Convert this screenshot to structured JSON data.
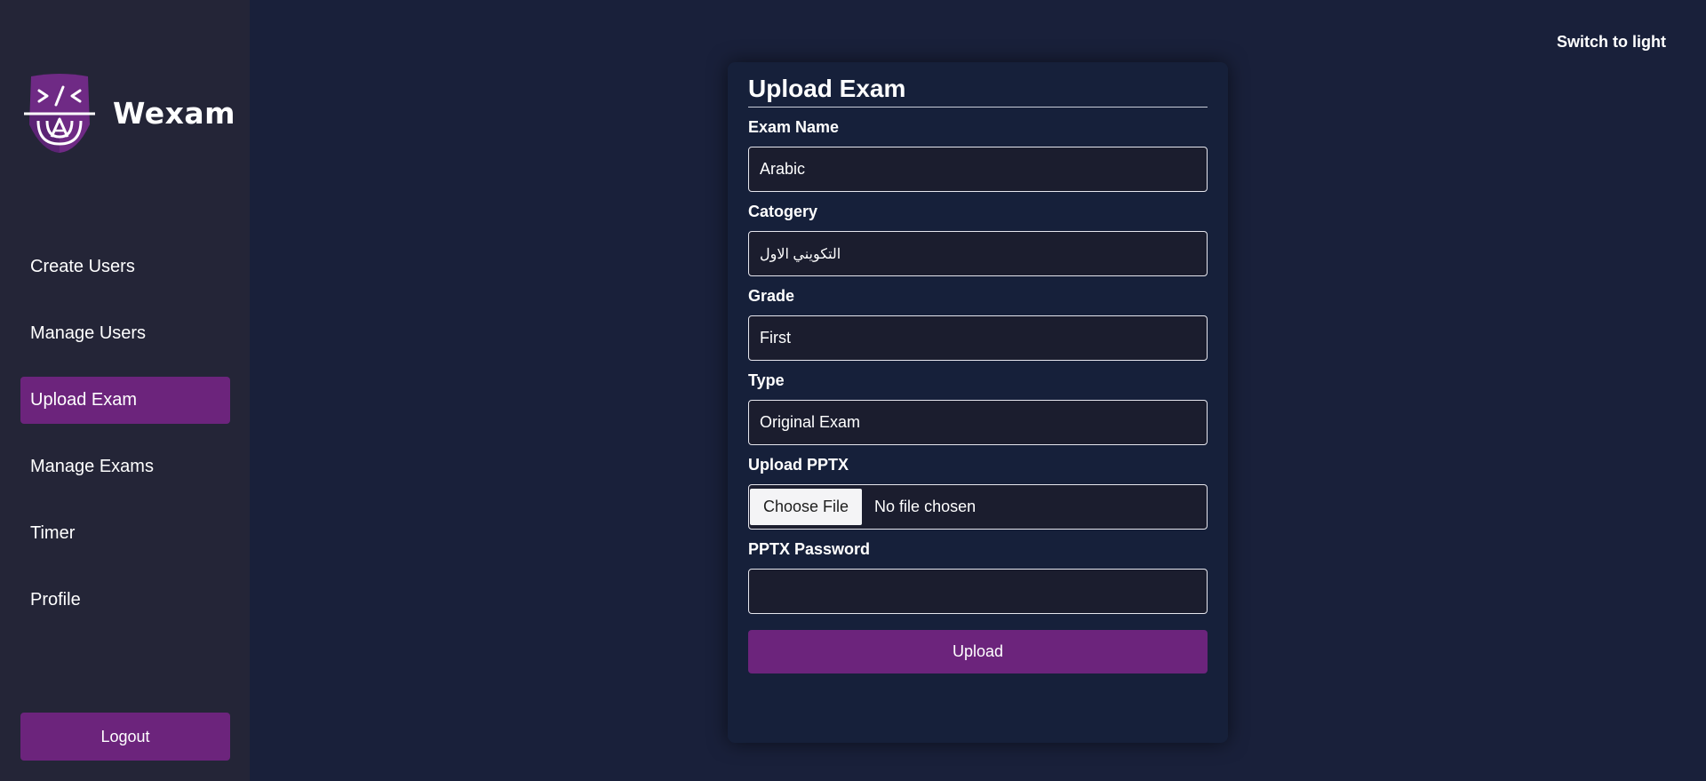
{
  "app": {
    "brand_name": "Wexam",
    "theme_toggle": "Switch to light"
  },
  "sidebar": {
    "items": [
      {
        "label": "Create Users"
      },
      {
        "label": "Manage Users"
      },
      {
        "label": "Upload Exam",
        "active": true
      },
      {
        "label": "Manage Exams"
      },
      {
        "label": "Timer"
      },
      {
        "label": "Profile"
      }
    ],
    "logout_label": "Logout"
  },
  "form": {
    "title": "Upload Exam",
    "fields": {
      "exam_name": {
        "label": "Exam Name",
        "value": "Arabic"
      },
      "category": {
        "label": "Catogery",
        "value": "التكويني الاول"
      },
      "grade": {
        "label": "Grade",
        "value": "First"
      },
      "type": {
        "label": "Type",
        "value": "Original Exam"
      },
      "pptx": {
        "label": "Upload PPTX",
        "button_label": "Choose File",
        "status": "No file chosen"
      },
      "password": {
        "label": "PPTX Password",
        "value": ""
      }
    },
    "submit_label": "Upload"
  },
  "colors": {
    "background": "#19203a",
    "sidebar": "#242537",
    "accent": "#6c247c",
    "card": "#16203a"
  },
  "icons": {
    "logo": "code-shield-logo-icon"
  }
}
